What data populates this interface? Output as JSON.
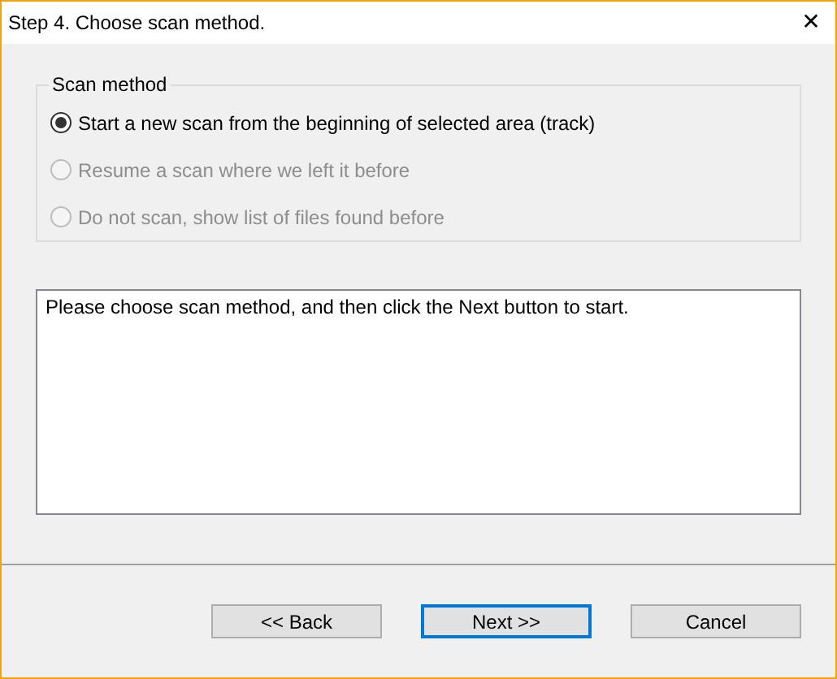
{
  "window": {
    "title": "Step 4. Choose scan method.",
    "close": "✕"
  },
  "scan_method": {
    "legend": "Scan method",
    "options": [
      {
        "label": "Start a new scan from the beginning of selected area (track)",
        "selected": true,
        "disabled": false
      },
      {
        "label": "Resume a scan where we left it before",
        "selected": false,
        "disabled": true
      },
      {
        "label": "Do not scan, show list of files found before",
        "selected": false,
        "disabled": true
      }
    ]
  },
  "message": "Please choose scan method, and then click the Next button to start.",
  "buttons": [
    {
      "label": "<< Back",
      "focused": false
    },
    {
      "label": "Next >>",
      "focused": true
    },
    {
      "label": "Cancel",
      "focused": false
    }
  ]
}
